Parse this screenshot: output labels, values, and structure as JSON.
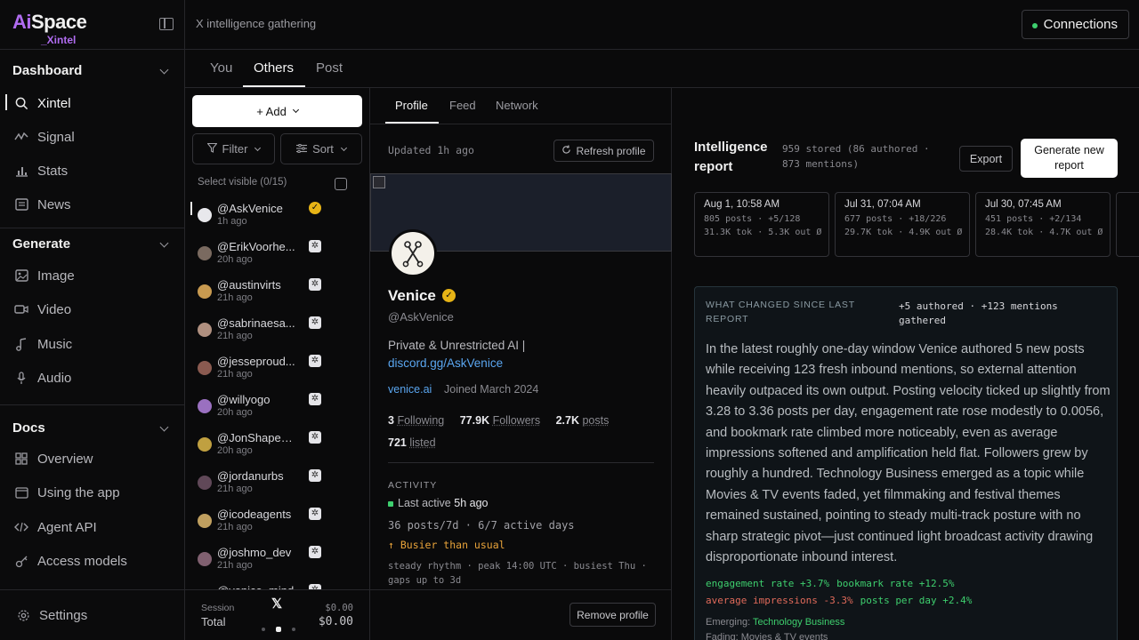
{
  "brand": {
    "logo_main": "AiSpace",
    "logo_sub": "_Xintel"
  },
  "sidebar": {
    "sections": [
      {
        "label": "Dashboard"
      },
      {
        "label": "Generate"
      },
      {
        "label": "Docs"
      }
    ],
    "dashboard_items": [
      {
        "label": "Xintel",
        "icon": "search-icon"
      },
      {
        "label": "Signal",
        "icon": "activity-icon"
      },
      {
        "label": "Stats",
        "icon": "bar-chart-icon"
      },
      {
        "label": "News",
        "icon": "newspaper-icon"
      }
    ],
    "generate_items": [
      {
        "label": "Image",
        "icon": "image-icon"
      },
      {
        "label": "Video",
        "icon": "video-icon"
      },
      {
        "label": "Music",
        "icon": "music-icon"
      },
      {
        "label": "Audio",
        "icon": "mic-icon"
      }
    ],
    "docs_items": [
      {
        "label": "Overview",
        "icon": "grid-icon"
      },
      {
        "label": "Using the app",
        "icon": "monitor-icon"
      },
      {
        "label": "Agent API",
        "icon": "code-icon"
      },
      {
        "label": "Access models",
        "icon": "key-icon"
      }
    ],
    "settings": "Settings"
  },
  "topbar": {
    "breadcrumb": "X intelligence gathering",
    "connections": "Connections"
  },
  "tabs": [
    "You",
    "Others",
    "Post"
  ],
  "list": {
    "add": "+ Add",
    "filter": "Filter",
    "sort": "Sort",
    "select_visible": "Select visible (0/15)",
    "items": [
      {
        "handle": "@AskVenice",
        "time": "1h ago",
        "badge": "gold"
      },
      {
        "handle": "@ErikVoorhe...",
        "time": "20h ago",
        "badge": "grok"
      },
      {
        "handle": "@austinvirts",
        "time": "21h ago",
        "badge": "grok"
      },
      {
        "handle": "@sabrinaesa...",
        "time": "21h ago",
        "badge": "grok"
      },
      {
        "handle": "@jesseproud...",
        "time": "21h ago",
        "badge": "grok"
      },
      {
        "handle": "@willyogo",
        "time": "20h ago",
        "badge": "grok"
      },
      {
        "handle": "@JonShapeS...",
        "time": "20h ago",
        "badge": "grok"
      },
      {
        "handle": "@jordanurbs",
        "time": "21h ago",
        "badge": "grok"
      },
      {
        "handle": "@icodeagents",
        "time": "21h ago",
        "badge": "grok"
      },
      {
        "handle": "@joshmo_dev",
        "time": "21h ago",
        "badge": "grok"
      },
      {
        "handle": "@venice_mind",
        "time": "",
        "badge": "grok"
      }
    ],
    "footer": {
      "session_label": "Session",
      "session_value": "$0.00",
      "total_label": "Total",
      "total_value": "$0.00",
      "x_logo": "𝕏"
    }
  },
  "profile": {
    "tabs": [
      "Profile",
      "Feed",
      "Network"
    ],
    "updated": "Updated 1h ago",
    "refresh": "Refresh profile",
    "name": "Venice",
    "handle": "@AskVenice",
    "bio_text": "Private & Unrestricted AI |",
    "bio_link": "discord.gg/AskVenice",
    "website": "venice.ai",
    "joined": "Joined March 2024",
    "following": "3",
    "following_label": "Following",
    "followers": "77.9K",
    "followers_label": "Followers",
    "posts": "2.7K",
    "posts_label": "posts",
    "listed": "721",
    "listed_label": "listed",
    "activity_header": "ACTIVITY",
    "last_active_label": "Last active",
    "last_active": "5h ago",
    "posts7d": "36 posts/7d · 6/7 active days",
    "busier": "↑ Busier than usual",
    "rhythm": "steady rhythm · peak 14:00 UTC · busiest Thu · gaps up to 3d",
    "remove": "Remove profile"
  },
  "report": {
    "title": "Intelligence report",
    "stored": "959 stored (86 authored · 873 mentions)",
    "export": "Export",
    "generate": "Generate new report",
    "snapshots": [
      {
        "date": "Aug 1, 10:58 AM",
        "line1": "805 posts · +5/128",
        "line2": "31.3K tok · 5.3K out Ø"
      },
      {
        "date": "Jul 31, 07:04 AM",
        "line1": "677 posts · +18/226",
        "line2": "29.7K tok · 4.9K out Ø"
      },
      {
        "date": "Jul 30, 07:45 AM",
        "line1": "451 posts · +2/134",
        "line2": "28.4K tok · 4.7K out Ø"
      }
    ],
    "changed_header": "WHAT CHANGED SINCE LAST REPORT",
    "changed_summary": "+5 authored · +123 mentions gathered",
    "changed_body": "In the latest roughly one-day window Venice authored 5 new posts while receiving 123 fresh inbound mentions, so external attention heavily outpaced its own output. Posting velocity ticked up slightly from 3.28 to 3.36 posts per day, engagement rate rose modestly to 0.0056, and bookmark rate climbed more noticeably, even as average impressions softened and amplification held flat. Followers grew by roughly a hundred. Technology Business emerged as a topic while Movies & TV events faded, yet filmmaking and festival themes remained sustained, pointing to steady multi-track posture with no sharp strategic pivot—just continued light broadcast activity drawing disproportionate inbound interest.",
    "metrics_pos": [
      "engagement rate +3.7%",
      "bookmark rate +12.5%"
    ],
    "metrics_neg": [
      "average impressions -3.3%"
    ],
    "metrics_pos2": [
      "posts per day +2.4%"
    ],
    "emerging_label": "Emerging:",
    "emerging": "Technology Business",
    "fading_label": "Fading:",
    "fading": "Movies & TV events"
  }
}
